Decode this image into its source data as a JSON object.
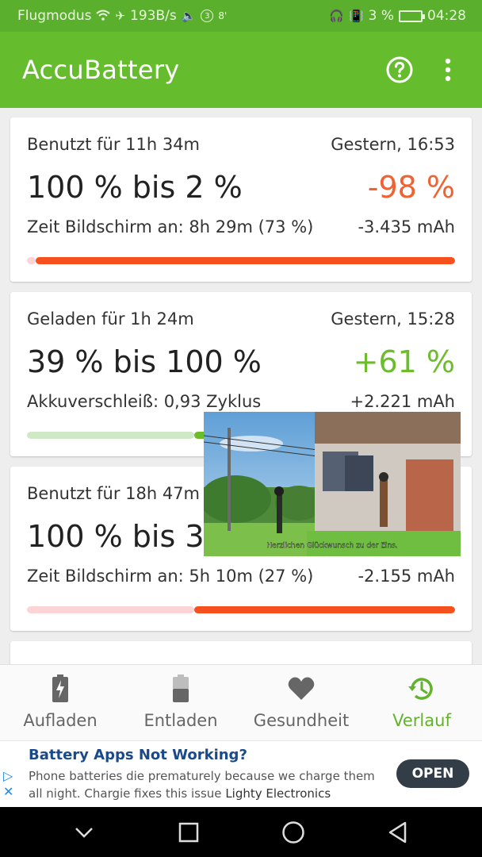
{
  "status_bar": {
    "mode": "Flugmodus",
    "speed": "193B/s",
    "notif_count": "3",
    "notif_extra": "8'",
    "battery_pct": "3 %",
    "time": "04:28"
  },
  "app": {
    "title": "AccuBattery",
    "help_icon": "help-circle-icon",
    "menu_icon": "more-vert-icon"
  },
  "sessions": [
    {
      "duration": "Benutzt für 11h 34m",
      "date": "Gestern, 16:53",
      "range": "100 % bis 2 %",
      "delta": "-98 %",
      "detail": "Zeit Bildschirm an: 8h 29m (73 %)",
      "mah": "-3.435 mAh",
      "bar": {
        "start_pct": 2,
        "end_pct": 100,
        "color": "#f4511e",
        "track": "#fcd4d6"
      }
    },
    {
      "duration": "Geladen für 1h 24m",
      "date": "Gestern, 15:28",
      "range": "39 % bis 100 %",
      "delta": "+61 %",
      "detail": "Akkuverschleiß: 0,93 Zyklus",
      "mah": "+2.221 mAh",
      "bar": {
        "start_pct": 39,
        "end_pct": 100,
        "color": "#6cbc2c",
        "track": "#cfe8c6"
      }
    },
    {
      "duration": "Benutzt für 18h 47m",
      "date": "",
      "range": "100 % bis 3",
      "delta": "",
      "detail": "Zeit Bildschirm an: 5h 10m (27 %)",
      "mah": "-2.155 mAh",
      "bar": {
        "start_pct": 39,
        "end_pct": 100,
        "color": "#f4511e",
        "track": "#fcd4d6"
      }
    }
  ],
  "video_overlay": {
    "subtitle": "Herzlichen Glückwunsch zu der Eins."
  },
  "bottom_nav": [
    {
      "label": "Aufladen",
      "icon": "battery-charging-icon",
      "active": false
    },
    {
      "label": "Entladen",
      "icon": "battery-discharge-icon",
      "active": false
    },
    {
      "label": "Gesundheit",
      "icon": "heart-icon",
      "active": false
    },
    {
      "label": "Verlauf",
      "icon": "history-icon",
      "active": true
    }
  ],
  "ad": {
    "title": "Battery Apps Not Working?",
    "text": "Phone batteries die prematurely because we charge them all night. Chargie fixes this issue",
    "advertiser": "Lighty Electronics",
    "cta": "OPEN"
  },
  "colors": {
    "app_bar": "#65bd2d",
    "status_bar": "#5aaf2c",
    "negative": "#f06232",
    "positive": "#6cbc2c"
  }
}
